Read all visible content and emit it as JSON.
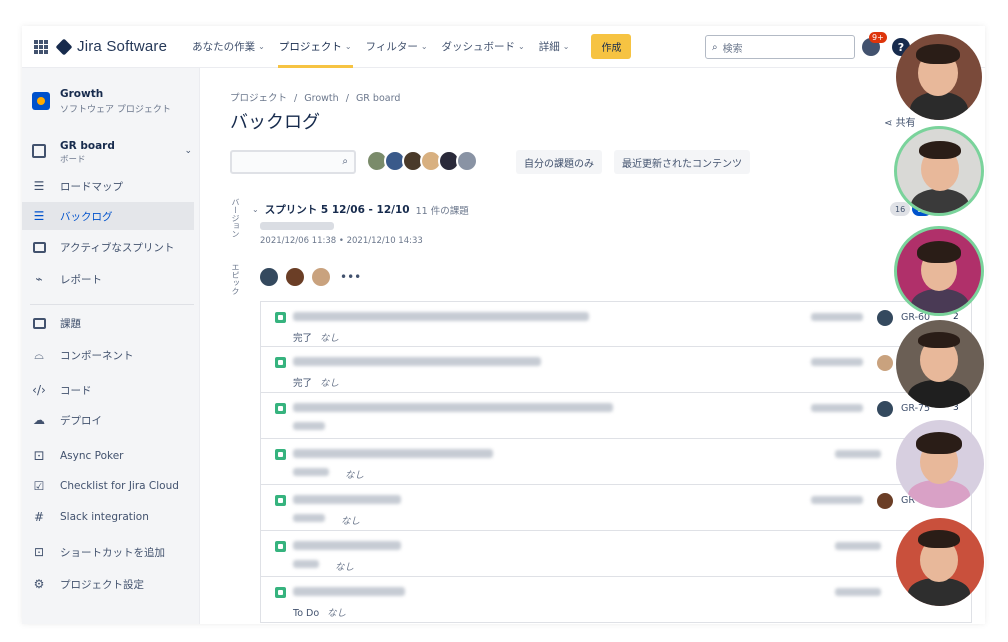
{
  "topnav": {
    "product": "Jira Software",
    "items": [
      {
        "label": "あなたの作業",
        "active": false
      },
      {
        "label": "プロジェクト",
        "active": true
      },
      {
        "label": "フィルター",
        "active": false
      },
      {
        "label": "ダッシュボード",
        "active": false
      },
      {
        "label": "詳細",
        "active": false
      }
    ],
    "create_label": "作成",
    "search_placeholder": "検索",
    "notification_badge": "9+",
    "help_label": "?"
  },
  "sidebar": {
    "project_name": "Growth",
    "project_type": "ソフトウェア プロジェクト",
    "board_name": "GR board",
    "board_type": "ボード",
    "items": [
      {
        "label": "ロードマップ",
        "icon": "roadmap-icon",
        "selected": false
      },
      {
        "label": "バックログ",
        "icon": "backlog-icon",
        "selected": true
      },
      {
        "label": "アクティブなスプリント",
        "icon": "board-icon",
        "selected": false
      },
      {
        "label": "レポート",
        "icon": "chart-icon",
        "selected": false
      },
      {
        "label": "課題",
        "icon": "issues-icon",
        "selected": false
      },
      {
        "label": "コンポーネント",
        "icon": "component-icon",
        "selected": false
      },
      {
        "label": "コード",
        "icon": "code-icon",
        "selected": false
      },
      {
        "label": "デプロイ",
        "icon": "deploy-icon",
        "selected": false
      },
      {
        "label": "Async Poker",
        "icon": "poker-icon",
        "selected": false
      },
      {
        "label": "Checklist for Jira Cloud",
        "icon": "checklist-icon",
        "selected": false
      },
      {
        "label": "Slack integration",
        "icon": "slack-icon",
        "selected": false
      },
      {
        "label": "ショートカットを追加",
        "icon": "add-shortcut-icon",
        "selected": false
      },
      {
        "label": "プロジェクト設定",
        "icon": "gear-icon",
        "selected": false
      }
    ]
  },
  "main": {
    "breadcrumb": [
      "プロジェクト",
      "Growth",
      "GR board"
    ],
    "breadcrumb_sep": "/",
    "title": "バックログ",
    "share_label": "共有",
    "quick_filters": [
      "自分の課題のみ",
      "最近更新されたコンテンツ"
    ],
    "vertical_labels": [
      "バージョン",
      "エピック"
    ],
    "sprint": {
      "name": "スプリント 5 12/06 - 12/10",
      "issue_count": "11 件の課題",
      "dates": "2021/12/06 11:38 • 2021/12/10 14:33",
      "pill_todo": "16",
      "pill_inprogress": "11"
    },
    "issues": [
      {
        "status": "完了",
        "none": "なし",
        "key": "GR-60",
        "points": "2"
      },
      {
        "status": "完了",
        "none": "なし",
        "key": "",
        "points": ""
      },
      {
        "status": "",
        "none": "",
        "key": "GR-75",
        "points": "3"
      },
      {
        "status": "",
        "none": "なし",
        "key": "",
        "points": ""
      },
      {
        "status": "",
        "none": "なし",
        "key": "GR",
        "points": ""
      },
      {
        "status": "",
        "none": "なし",
        "key": "",
        "points": ""
      },
      {
        "status": "To Do",
        "none": "なし",
        "key": "",
        "points": ""
      }
    ]
  },
  "colors": {
    "accent": "#f6c342",
    "selected_text": "#0052cc",
    "story_green": "#36b37e"
  }
}
